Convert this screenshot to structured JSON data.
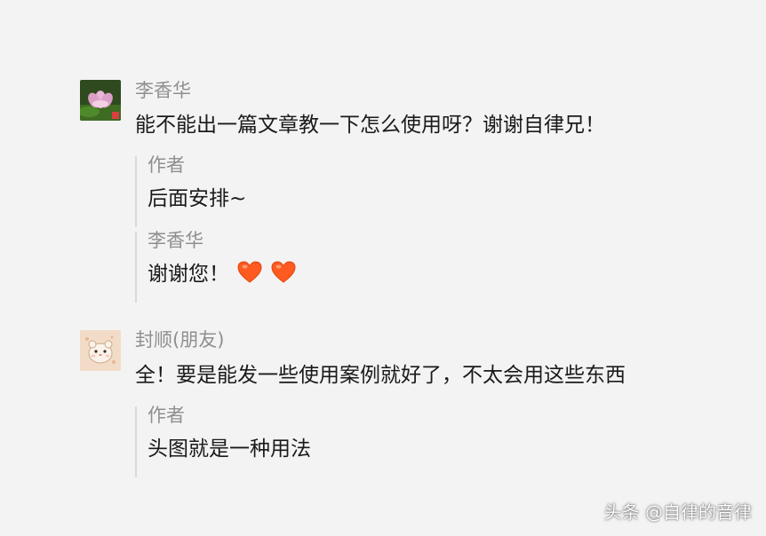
{
  "comments": [
    {
      "author": "李香华",
      "text": "能不能出一篇文章教一下怎么使用呀？谢谢自律兄！",
      "avatar_icon": "lotus-flower-avatar",
      "replies": [
        {
          "author": "作者",
          "text": "后面安排~"
        },
        {
          "author": "李香华",
          "text": "谢谢您！",
          "icons": [
            "heart-icon",
            "heart-icon"
          ]
        }
      ]
    },
    {
      "author": "封顺(朋友)",
      "text": "全！要是能发一些使用案例就好了，不太会用这些东西",
      "avatar_icon": "hamster-avatar",
      "replies": [
        {
          "author": "作者",
          "text": "头图就是一种用法"
        }
      ]
    }
  ],
  "watermark": "头条 @自律的音律",
  "colors": {
    "background": "#f3f3f3",
    "name": "#8f8f8f",
    "text": "#1a1a1a",
    "heart": "#ff5a1f"
  }
}
